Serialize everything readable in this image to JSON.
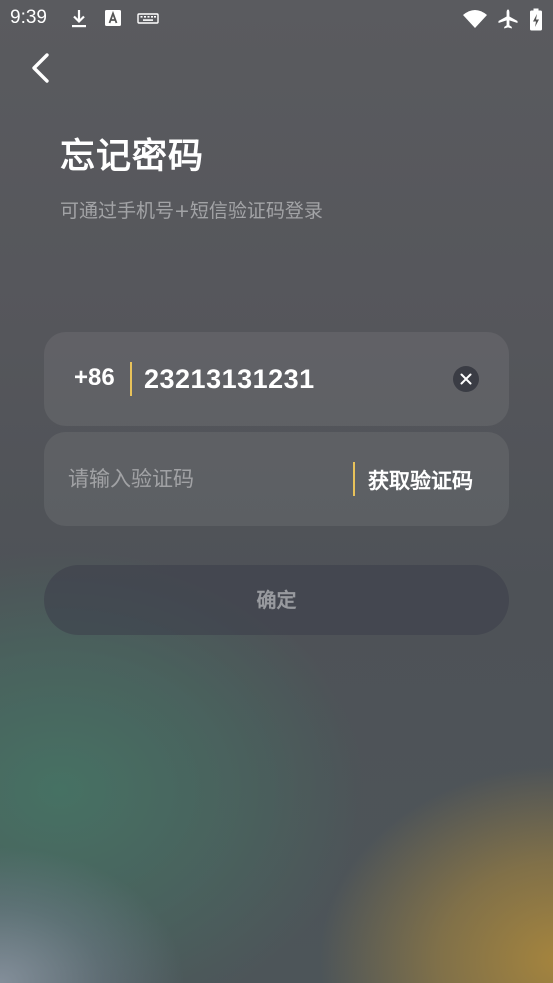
{
  "status_bar": {
    "time": "9:39",
    "icons_left": [
      "download-icon",
      "font-a-icon",
      "keyboard-icon"
    ],
    "icons_right": [
      "wifi-icon",
      "airplane-mode-icon",
      "battery-charging-icon"
    ]
  },
  "header": {
    "back_icon": "chevron-left-icon",
    "title": "忘记密码",
    "subtitle": "可通过手机号+短信验证码登录"
  },
  "form": {
    "country_code": "+86",
    "phone_value": "23213131231",
    "clear_icon": "close-circle-icon",
    "code_placeholder": "请输入验证码",
    "code_value": "",
    "get_code_label": "获取验证码",
    "confirm_label": "确定"
  },
  "colors": {
    "accent": "#e8c25a",
    "text_primary": "#ffffff"
  }
}
